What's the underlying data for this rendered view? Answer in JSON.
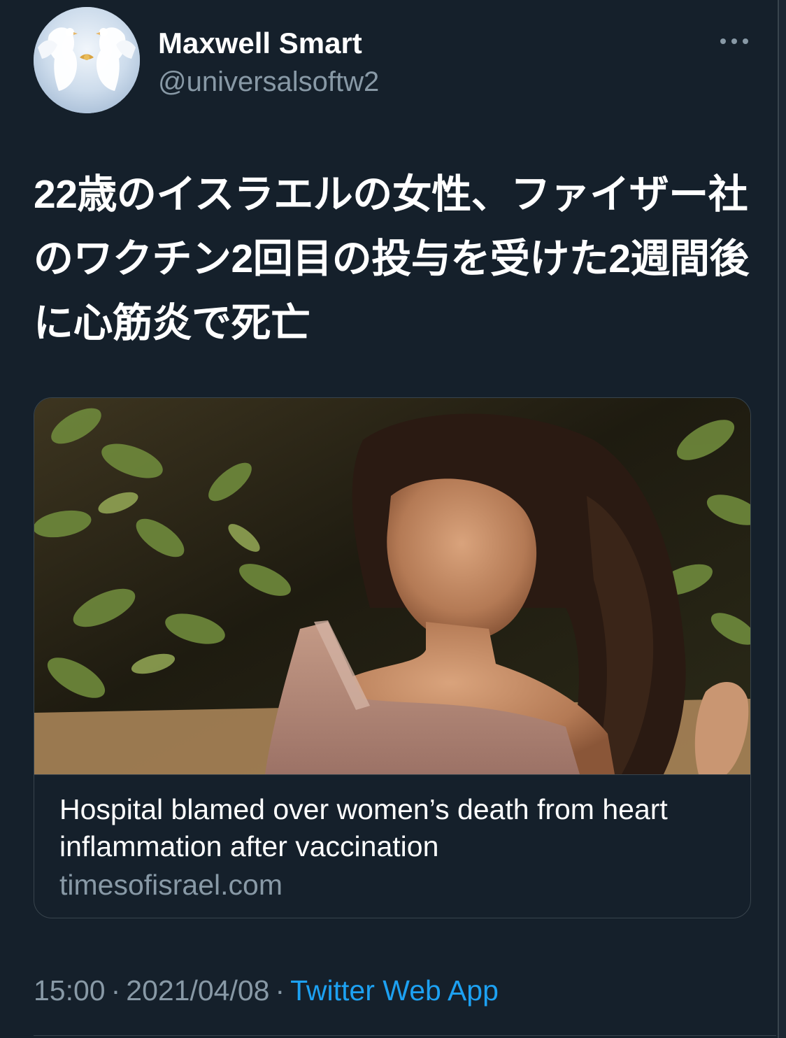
{
  "theme": {
    "background": "#15202b",
    "primary_text": "#ffffff",
    "secondary_text": "#8899a6",
    "link": "#1da1f2",
    "border": "#38444d"
  },
  "author": {
    "name": "Maxwell Smart",
    "handle": "@universalsoftw2",
    "avatar_icon": "avatar-doves-icon"
  },
  "more_icon": "more-options-icon",
  "tweet": {
    "text": "22歳のイスラエルの女性、ファイザー社のワクチン2回目の投与を受けた2週間後に心筋炎で死亡"
  },
  "link_card": {
    "image_icon": "article-photo",
    "title": "Hospital blamed over women’s death from heart inflammation after vaccination",
    "domain": "timesofisrael.com"
  },
  "meta": {
    "time": "15:00",
    "date": "2021/04/08",
    "separator": "·",
    "source": "Twitter Web App"
  }
}
